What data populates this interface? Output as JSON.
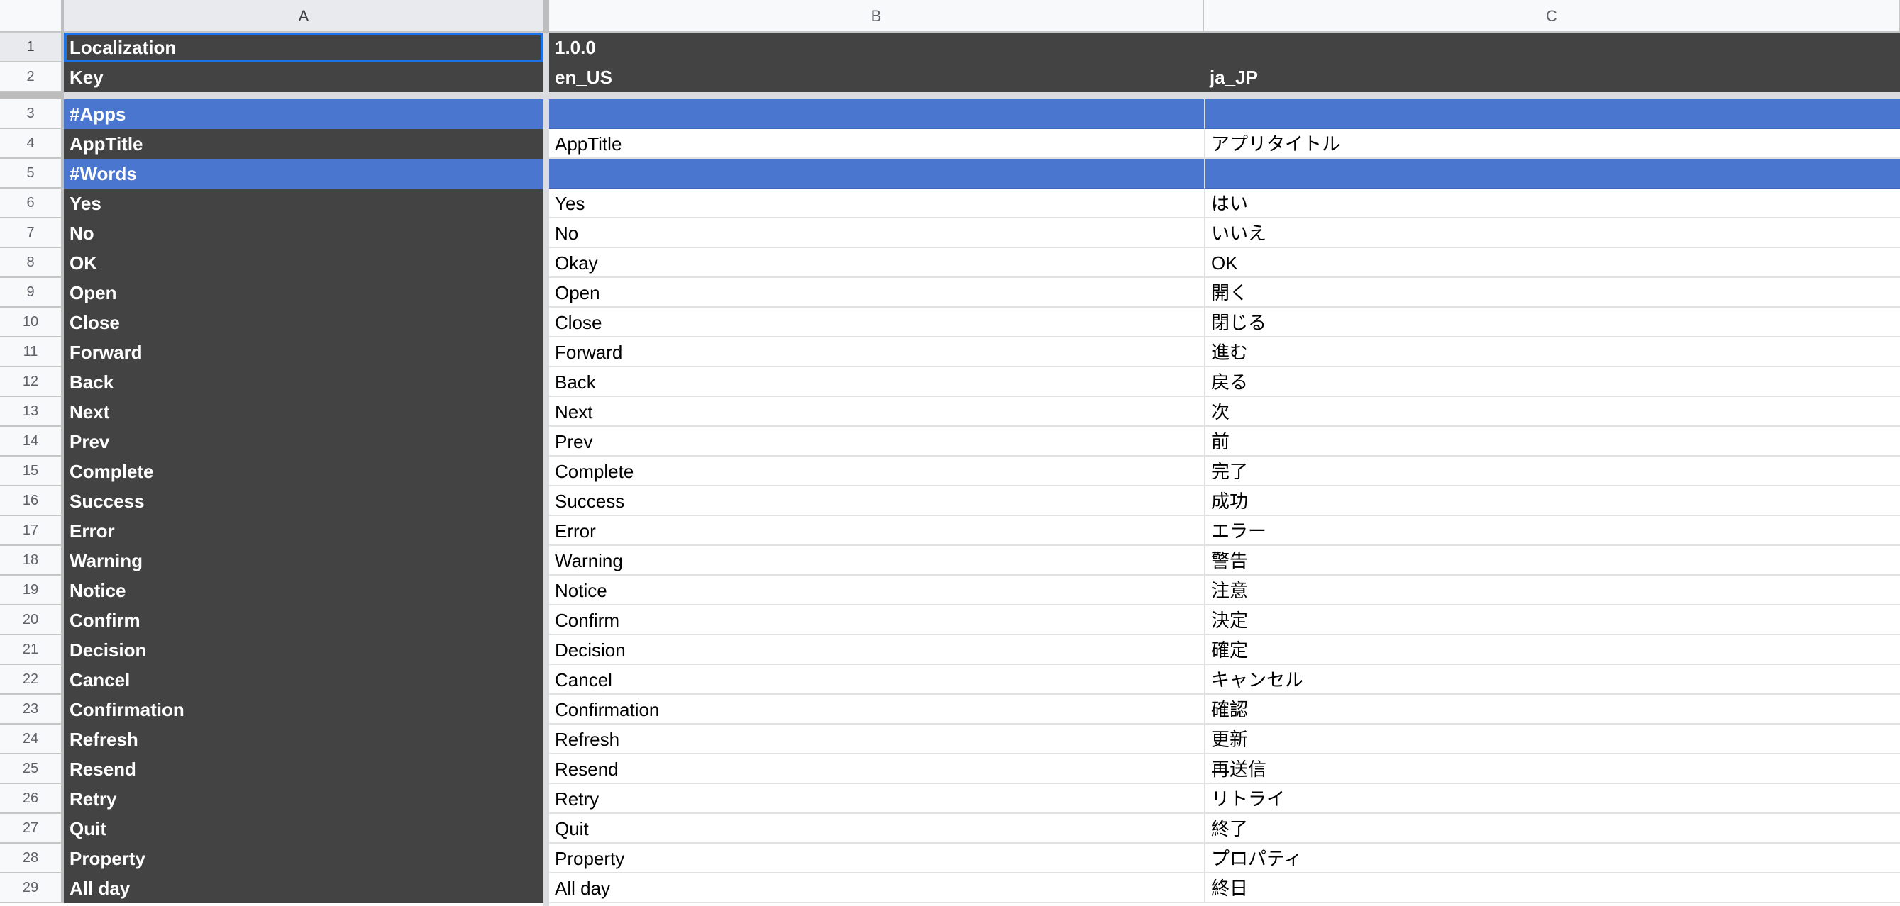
{
  "sheet": {
    "column_headers": [
      "A",
      "B",
      "C"
    ],
    "selected_cell": "A1",
    "rows": [
      {
        "num": "1",
        "a": "Localization",
        "b": "1.0.0",
        "c": "",
        "style": "header"
      },
      {
        "num": "2",
        "a": "Key",
        "b": "en_US",
        "c": "ja_JP",
        "style": "header"
      },
      {
        "num": "3",
        "a": "#Apps",
        "b": "",
        "c": "",
        "style": "section"
      },
      {
        "num": "4",
        "a": "AppTitle",
        "b": "AppTitle",
        "c": "アプリタイトル",
        "style": "entry"
      },
      {
        "num": "5",
        "a": "#Words",
        "b": "",
        "c": "",
        "style": "section"
      },
      {
        "num": "6",
        "a": "Yes",
        "b": "Yes",
        "c": "はい",
        "style": "entry"
      },
      {
        "num": "7",
        "a": "No",
        "b": "No",
        "c": "いいえ",
        "style": "entry"
      },
      {
        "num": "8",
        "a": "OK",
        "b": "Okay",
        "c": "OK",
        "style": "entry"
      },
      {
        "num": "9",
        "a": "Open",
        "b": "Open",
        "c": "開く",
        "style": "entry"
      },
      {
        "num": "10",
        "a": "Close",
        "b": "Close",
        "c": "閉じる",
        "style": "entry"
      },
      {
        "num": "11",
        "a": "Forward",
        "b": "Forward",
        "c": "進む",
        "style": "entry"
      },
      {
        "num": "12",
        "a": "Back",
        "b": "Back",
        "c": "戻る",
        "style": "entry"
      },
      {
        "num": "13",
        "a": "Next",
        "b": "Next",
        "c": "次",
        "style": "entry"
      },
      {
        "num": "14",
        "a": "Prev",
        "b": "Prev",
        "c": "前",
        "style": "entry"
      },
      {
        "num": "15",
        "a": "Complete",
        "b": "Complete",
        "c": "完了",
        "style": "entry"
      },
      {
        "num": "16",
        "a": "Success",
        "b": "Success",
        "c": "成功",
        "style": "entry"
      },
      {
        "num": "17",
        "a": "Error",
        "b": "Error",
        "c": "エラー",
        "style": "entry"
      },
      {
        "num": "18",
        "a": "Warning",
        "b": "Warning",
        "c": "警告",
        "style": "entry"
      },
      {
        "num": "19",
        "a": "Notice",
        "b": "Notice",
        "c": "注意",
        "style": "entry"
      },
      {
        "num": "20",
        "a": "Confirm",
        "b": "Confirm",
        "c": "決定",
        "style": "entry"
      },
      {
        "num": "21",
        "a": "Decision",
        "b": "Decision",
        "c": "確定",
        "style": "entry"
      },
      {
        "num": "22",
        "a": "Cancel",
        "b": "Cancel",
        "c": "キャンセル",
        "style": "entry"
      },
      {
        "num": "23",
        "a": "Confirmation",
        "b": "Confirmation",
        "c": "確認",
        "style": "entry"
      },
      {
        "num": "24",
        "a": "Refresh",
        "b": "Refresh",
        "c": "更新",
        "style": "entry"
      },
      {
        "num": "25",
        "a": "Resend",
        "b": "Resend",
        "c": "再送信",
        "style": "entry"
      },
      {
        "num": "26",
        "a": "Retry",
        "b": "Retry",
        "c": "リトライ",
        "style": "entry"
      },
      {
        "num": "27",
        "a": "Quit",
        "b": "Quit",
        "c": "終了",
        "style": "entry"
      },
      {
        "num": "28",
        "a": "Property",
        "b": "Property",
        "c": "プロパティ",
        "style": "entry"
      },
      {
        "num": "29",
        "a": "All day",
        "b": "All day",
        "c": "終日",
        "style": "entry"
      }
    ]
  },
  "colors": {
    "header_bg": "#434343",
    "section_bg": "#4a76d0",
    "selection_border": "#1a73e8"
  }
}
